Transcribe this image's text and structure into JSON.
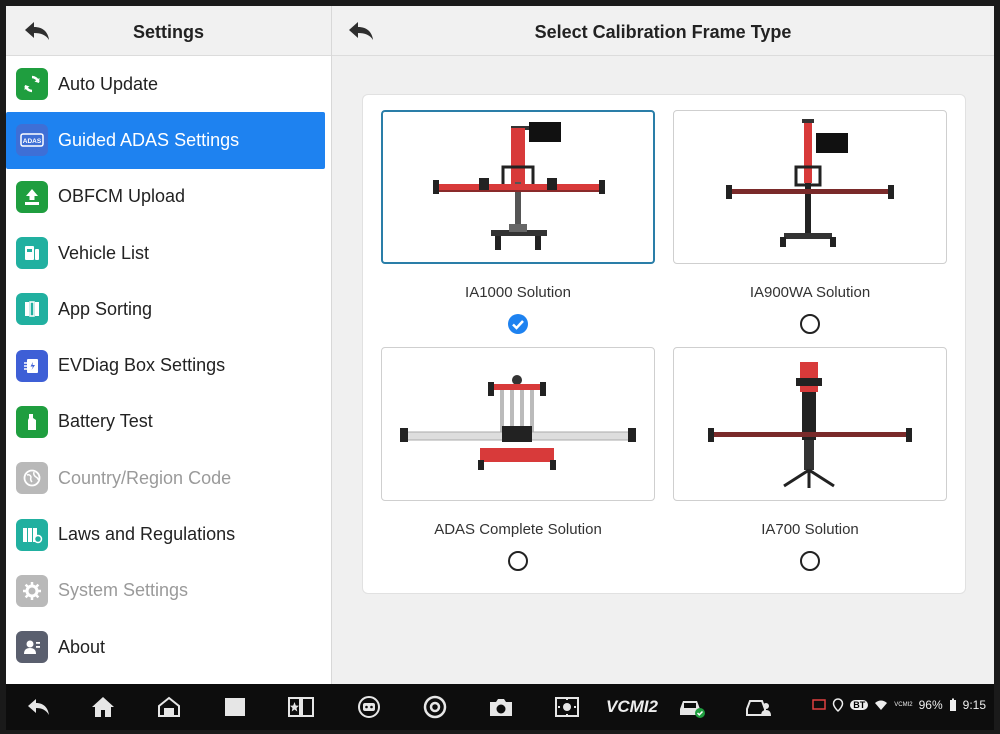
{
  "left_panel": {
    "title": "Settings",
    "items": [
      {
        "label": "Auto Update",
        "icon": "refresh-icon",
        "color": "#1f9e3f",
        "active": false,
        "disabled": false
      },
      {
        "label": "Guided ADAS Settings",
        "icon": "adas-icon",
        "color": "#3e6fd6",
        "active": true,
        "disabled": false
      },
      {
        "label": "OBFCM Upload",
        "icon": "upload-icon",
        "color": "#1f9e3f",
        "active": false,
        "disabled": false
      },
      {
        "label": "Vehicle List",
        "icon": "vehicle-list-icon",
        "color": "#21b0a0",
        "active": false,
        "disabled": false
      },
      {
        "label": "App Sorting",
        "icon": "app-sorting-icon",
        "color": "#21b0a0",
        "active": false,
        "disabled": false
      },
      {
        "label": "EVDiag Box Settings",
        "icon": "evdiag-box-icon",
        "color": "#3e5fd6",
        "active": false,
        "disabled": false
      },
      {
        "label": "Battery Test",
        "icon": "battery-test-icon",
        "color": "#1f9e3f",
        "active": false,
        "disabled": false
      },
      {
        "label": "Country/Region Code",
        "icon": "globe-icon",
        "color": "#b9b9b9",
        "active": false,
        "disabled": true
      },
      {
        "label": "Laws and Regulations",
        "icon": "laws-icon",
        "color": "#21b0a0",
        "active": false,
        "disabled": false
      },
      {
        "label": "System Settings",
        "icon": "gear-icon",
        "color": "#b9b9b9",
        "active": false,
        "disabled": true
      },
      {
        "label": "About",
        "icon": "about-icon",
        "color": "#5a5f6e",
        "active": false,
        "disabled": false
      }
    ]
  },
  "right_panel": {
    "title": "Select Calibration Frame Type",
    "options": [
      {
        "label": "IA1000 Solution",
        "selected": true
      },
      {
        "label": "IA900WA Solution",
        "selected": false
      },
      {
        "label": "ADAS Complete Solution",
        "selected": false
      },
      {
        "label": "IA700 Solution",
        "selected": false
      }
    ]
  },
  "status_bar": {
    "battery": "96%",
    "time": "9:15",
    "bt": "BT",
    "vcmi_label": "VCMI2"
  },
  "navbar": {
    "vcmi_text": "VCMI2"
  },
  "colors": {
    "accent": "#1e82f0",
    "selected_border": "#2a7ea8",
    "frame_red": "#d83a3a",
    "frame_dark": "#2b2b2b"
  }
}
